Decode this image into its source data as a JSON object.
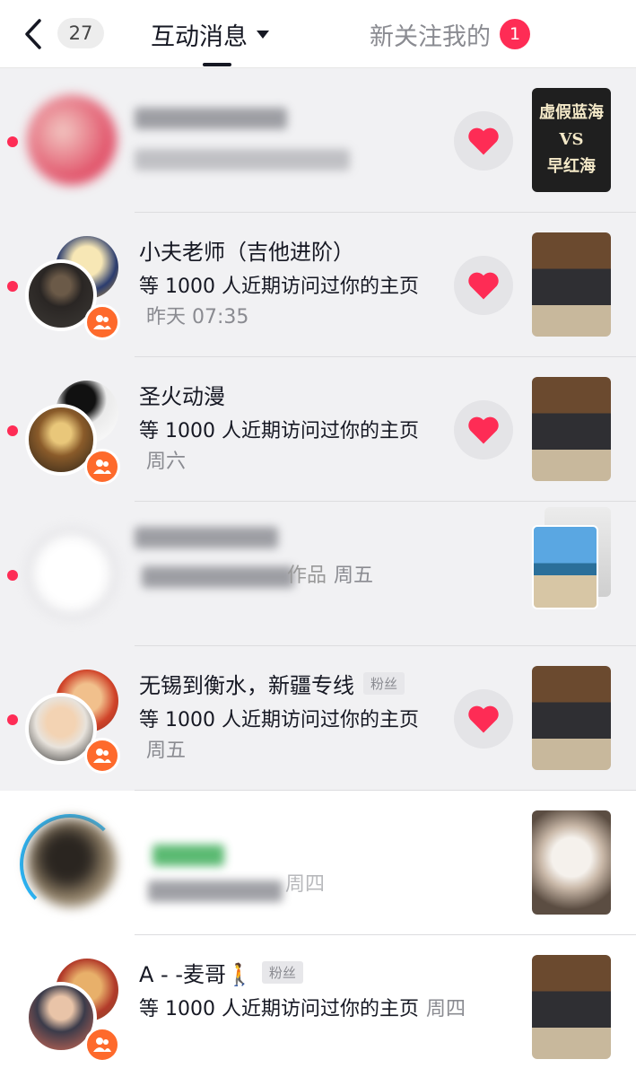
{
  "header": {
    "unread_count": "27",
    "tab_active": "互动消息",
    "tab_follow": "新关注我的",
    "follow_badge": "1"
  },
  "thumb_text": [
    "虚假蓝海",
    "VS",
    "早红海"
  ],
  "rows": [
    {
      "name": "",
      "message": "",
      "time": "",
      "tag": "",
      "unread": true
    },
    {
      "name": "小夫老师（吉他进阶）",
      "message": "等 1000 人近期访问过你的主页",
      "time": "昨天 07:35",
      "tag": "",
      "unread": true
    },
    {
      "name": "圣火动漫",
      "message": "等 1000 人近期访问过你的主页",
      "time": "周六",
      "tag": "",
      "unread": true
    },
    {
      "name": "",
      "message": "作品",
      "time": "周五",
      "tag": "",
      "unread": true
    },
    {
      "name": "无锡到衡水，新疆专线",
      "message": "等 1000 人近期访问过你的主页",
      "time": "周五",
      "tag": "粉丝",
      "unread": true
    },
    {
      "name": "",
      "message": "",
      "time": "周四",
      "tag": "",
      "unread": false
    },
    {
      "name": "A - -麦哥🚶",
      "message": "等 1000 人近期访问过你的主页",
      "time": "周四",
      "tag": "粉丝",
      "unread": false
    }
  ],
  "icons": {
    "back": "chevron-left-icon",
    "caret": "caret-down-icon",
    "heart": "heart-icon",
    "group": "group-icon"
  },
  "colors": {
    "accent": "#fe2c55",
    "group_badge": "#fe6a2c",
    "unread_bg": "#f1f1f3"
  }
}
